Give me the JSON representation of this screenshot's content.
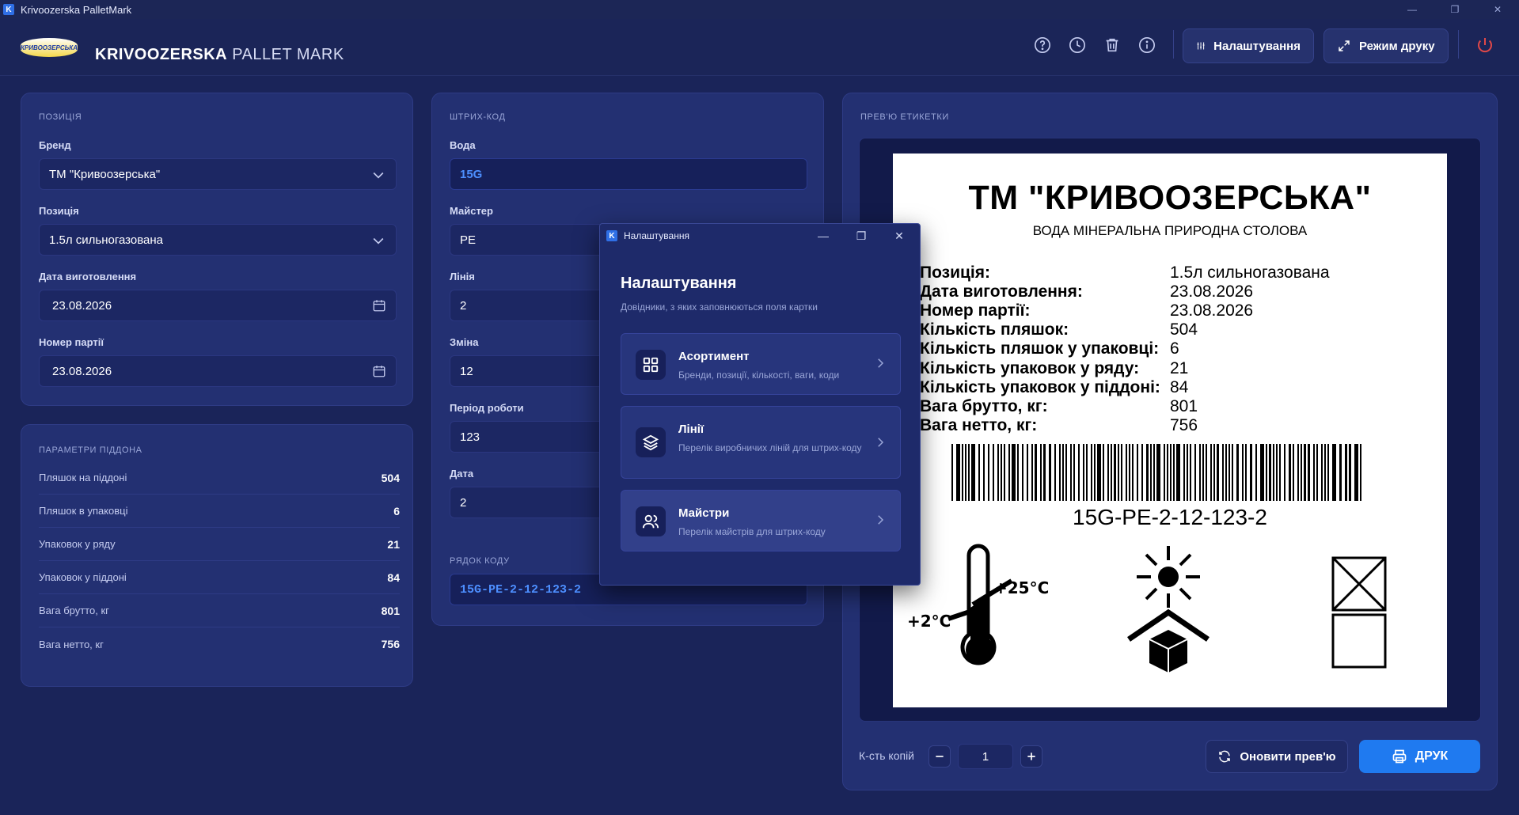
{
  "window": {
    "title": "Krivoozerska PalletMark",
    "app_icon_letter": "K",
    "controls": [
      "—",
      "❐",
      "✕"
    ]
  },
  "header": {
    "logo_text": "КРИВООЗЕРСЬКА",
    "brand_bold": "KRIVOOZERSKA",
    "brand_light": "PALLET MARK",
    "icons": [
      "help-icon",
      "history-icon",
      "trash-icon",
      "info-icon"
    ],
    "settings_label": "Налаштування",
    "print_mode_label": "Режим друку",
    "power_icon": "power-icon"
  },
  "position_panel": {
    "title": "ПОЗИЦІЯ",
    "brand_label": "Бренд",
    "brand_value": "ТМ \"Кривоозерська\"",
    "position_label": "Позиція",
    "position_value": "1.5л сильногазована",
    "mfg_date_label": "Дата виготовлення",
    "mfg_date_value": "23.08.2026",
    "batch_label": "Номер партії",
    "batch_value": "23.08.2026"
  },
  "pallet_panel": {
    "title": "ПАРАМЕТРИ ПІДДОНА",
    "rows": [
      {
        "label": "Пляшок на піддоні",
        "value": "504"
      },
      {
        "label": "Пляшок в упаковці",
        "value": "6"
      },
      {
        "label": "Упаковок у ряду",
        "value": "21"
      },
      {
        "label": "Упаковок у піддоні",
        "value": "84"
      },
      {
        "label": "Вага брутто, кг",
        "value": "801"
      },
      {
        "label": "Вага нетто, кг",
        "value": "756"
      }
    ]
  },
  "barcode_panel": {
    "title": "ШТРИХ-КОД",
    "water_label": "Вода",
    "water_value": "15G",
    "master_label": "Майстер",
    "master_value": "PE",
    "line_label": "Лінія",
    "line_value": "2",
    "shift_label": "Зміна",
    "shift_value": "12",
    "period_label": "Період роботи",
    "period_value": "123",
    "date_label": "Дата",
    "date_value": "2",
    "code_row_label": "РЯДОК КОДУ",
    "code_row_value": "15G-PE-2-12-123-2"
  },
  "preview_panel": {
    "title": "ПРЕВ'Ю ЕТИКЕТКИ",
    "label": {
      "brand": "ТМ \"КРИВООЗЕРСЬКА\"",
      "subtitle": "ВОДА МІНЕРАЛЬНА ПРИРОДНА СТОЛОВА",
      "rows": [
        {
          "k": "Позиція:",
          "v": "1.5л сильногазована"
        },
        {
          "k": "Дата виготовлення:",
          "v": "23.08.2026"
        },
        {
          "k": "Номер партії:",
          "v": "23.08.2026"
        },
        {
          "k": "Кількість пляшок:",
          "v": "504"
        },
        {
          "k": "Кількість пляшок у упаковці:",
          "v": "6"
        },
        {
          "k": "Кількість упаковок у ряду:",
          "v": "21"
        },
        {
          "k": "Кількість упаковок у піддоні:",
          "v": "84"
        },
        {
          "k": "Вага брутто, кг:",
          "v": "801"
        },
        {
          "k": "Вага нетто, кг:",
          "v": "756"
        }
      ],
      "barcode_text": "15G-PE-2-12-123-2",
      "temp_high": "+25°C",
      "temp_low": "+2°C"
    },
    "copies_label": "К-сть копій",
    "copies_value": "1",
    "refresh_label": "Оновити прев'ю",
    "print_label": "ДРУК"
  },
  "settings_dialog": {
    "window_title": "Налаштування",
    "heading": "Налаштування",
    "subtitle": "Довідники, з яких заповнюються поля картки",
    "items": [
      {
        "name": "Асортимент",
        "desc": "Бренди, позиції, кількості, ваги, коди",
        "icon": "grid-icon"
      },
      {
        "name": "Лінії",
        "desc": "Перелік виробничих ліній для штрих-коду",
        "icon": "layers-icon"
      },
      {
        "name": "Майстри",
        "desc": "Перелік майстрів для штрих-коду",
        "icon": "users-icon"
      }
    ]
  },
  "colors": {
    "background": "#1a2459",
    "panel": "#233072",
    "accent": "#1f7af0",
    "accent_text": "#4d8fff",
    "danger": "#e04848"
  }
}
